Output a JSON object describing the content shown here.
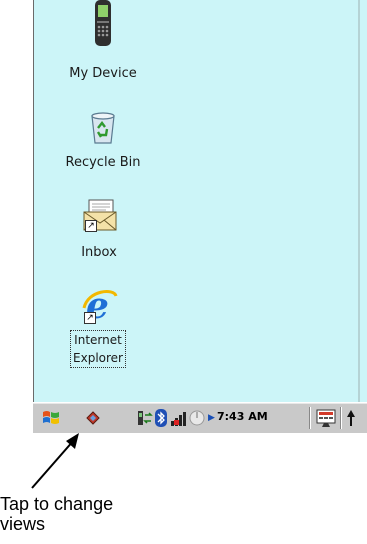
{
  "desktop": {
    "icons": [
      {
        "name": "my-device",
        "label": "My Device"
      },
      {
        "name": "recycle-bin",
        "label": "Recycle Bin"
      },
      {
        "name": "inbox",
        "label": "Inbox"
      },
      {
        "name": "internet-explorer",
        "label_line1": "Internet",
        "label_line2": "Explorer"
      }
    ]
  },
  "taskbar": {
    "clock": "7:43 AM",
    "icons": [
      "start-flag-icon",
      "change-views-icon",
      "sync-icon",
      "bluetooth-icon",
      "signal-strength-icon",
      "power-icon",
      "arrow-right-icon",
      "input-panel-icon",
      "up-arrow-icon"
    ]
  },
  "callout": {
    "line1": "Tap to change",
    "line2": "views"
  },
  "colors": {
    "desktop_bg": "#ccf5f8",
    "taskbar_bg": "#c9c9c9"
  }
}
